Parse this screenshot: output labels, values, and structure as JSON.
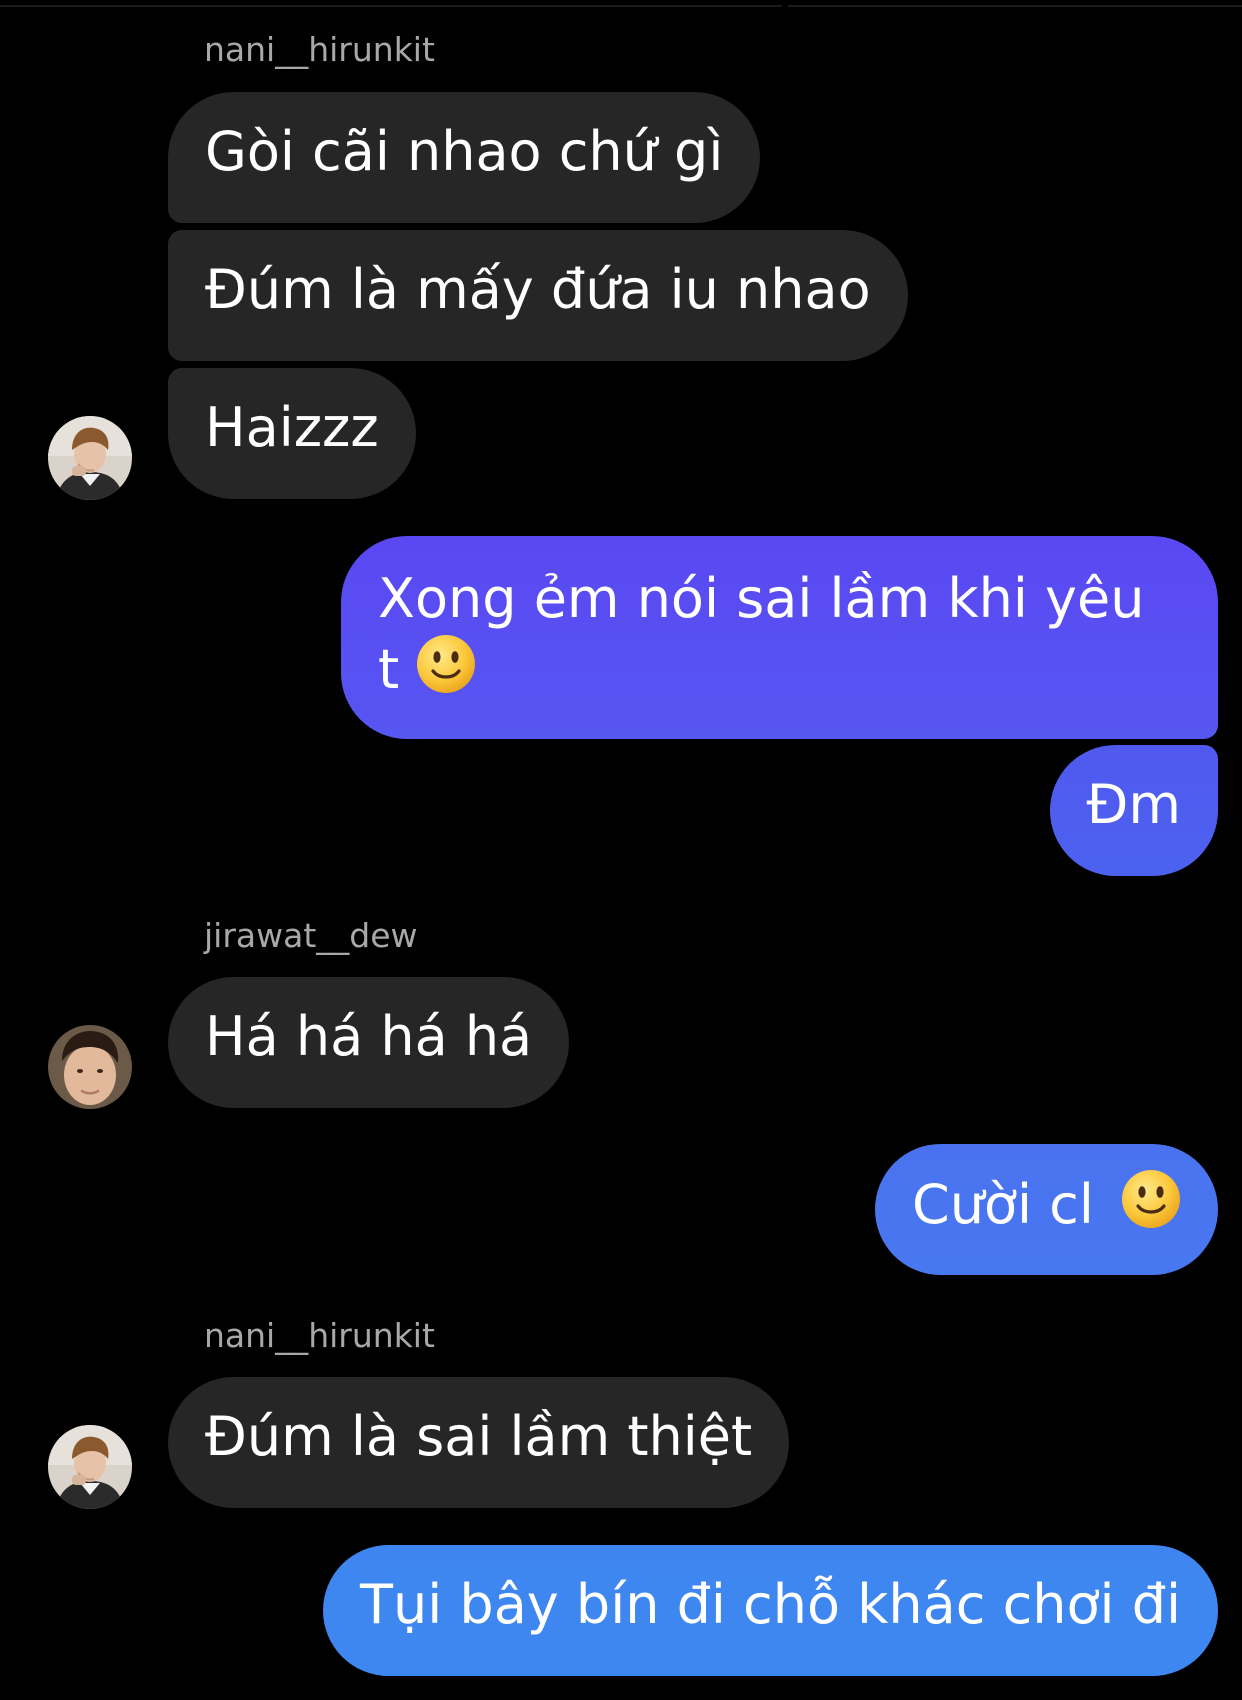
{
  "colors": {
    "background": "#000000",
    "incoming_bubble": "#262626",
    "outgoing_gradient_top": "#5b49f2",
    "outgoing_gradient_mid": "#5161ef",
    "outgoing_gradient_bottom": "#3e80f0",
    "sender_name": "#a8a8a8",
    "text": "#ffffff"
  },
  "conversation": {
    "messages": [
      {
        "sender": "nani__hirunkit",
        "text": "Gòi cãi nhao chứ gì"
      },
      {
        "text": "Đúm là mấy đứa iu nhao"
      },
      {
        "text": "Haizzz"
      },
      {
        "text": "Xong ẻm nói sai lầm khi yêu t",
        "emoji": "slightly-smiling-face"
      },
      {
        "text": "Đm"
      },
      {
        "sender": "jirawat__dew",
        "text": "Há há há há"
      },
      {
        "text": "Cười cl",
        "emoji": "slightly-smiling-face"
      },
      {
        "sender": "nani__hirunkit",
        "text": "Đúm là sai lầm thiệt"
      },
      {
        "text": "Tụi bây bín đi chỗ khác chơi đi"
      }
    ]
  }
}
